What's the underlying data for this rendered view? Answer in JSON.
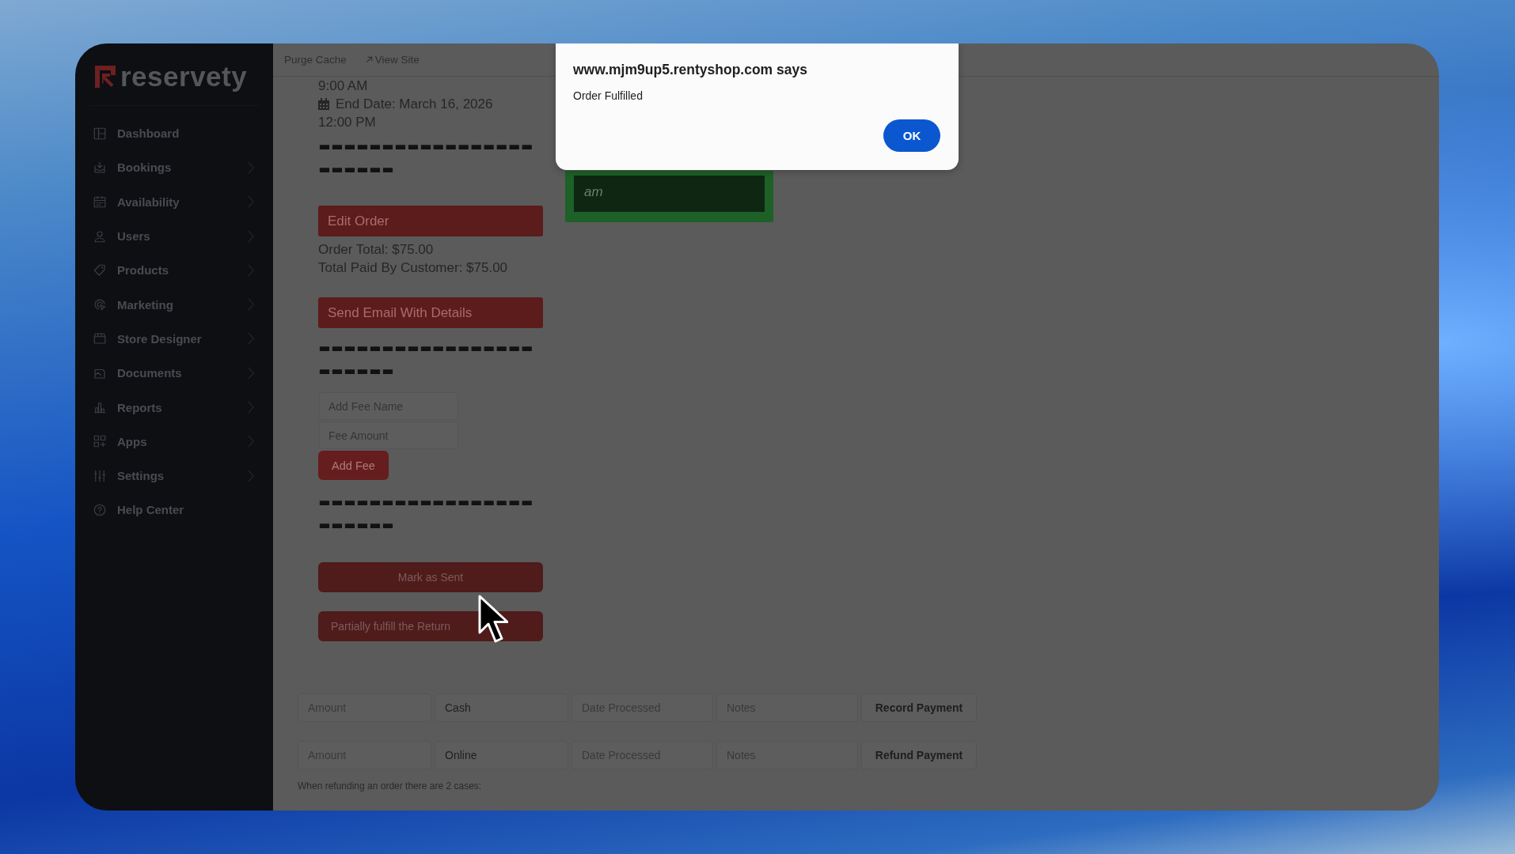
{
  "topbar": {
    "links": [
      {
        "label": "Purge Cache",
        "kind": "plain"
      },
      {
        "label": "View Site",
        "kind": "external"
      }
    ]
  },
  "sidebar": {
    "logo": "reservety",
    "items": [
      {
        "label": "Dashboard",
        "expandable": false
      },
      {
        "label": "Bookings",
        "expandable": true
      },
      {
        "label": "Availability",
        "expandable": true
      },
      {
        "label": "Users",
        "expandable": true
      },
      {
        "label": "Products",
        "expandable": true
      },
      {
        "label": "Marketing",
        "expandable": true
      },
      {
        "label": "Store Designer",
        "expandable": true
      },
      {
        "label": "Documents",
        "expandable": true
      },
      {
        "label": "Reports",
        "expandable": true
      },
      {
        "label": "Apps",
        "expandable": true
      },
      {
        "label": "Settings",
        "expandable": true
      },
      {
        "label": "Help Center",
        "expandable": false
      }
    ]
  },
  "order": {
    "blocks": [
      {
        "kind": "text",
        "text": "9:00 AM"
      },
      {
        "kind": "date",
        "text": "End Date: March 16, 2026"
      },
      {
        "kind": "text",
        "text": "12:00 PM"
      },
      {
        "kind": "divider",
        "text": "-----------------------"
      },
      {
        "kind": "button",
        "label": "Edit Order"
      },
      {
        "kind": "text",
        "text": "Order Total: $75.00"
      },
      {
        "kind": "text",
        "text": "Total Paid By Customer: $75.00"
      },
      {
        "kind": "button",
        "label": "Send Email With Details"
      },
      {
        "kind": "divider",
        "text": "-----------------------"
      },
      {
        "kind": "fee_form",
        "fields": [
          {
            "placeholder": "Add Fee Name"
          },
          {
            "placeholder": "Fee Amount"
          }
        ],
        "button": "Add Fee"
      },
      {
        "kind": "divider",
        "text": "-----------------------"
      },
      {
        "kind": "action",
        "label": "Mark as Sent",
        "centered": true
      },
      {
        "kind": "action",
        "label": "Partially fulfill the Return",
        "centered": false
      }
    ]
  },
  "note": {
    "text": "am"
  },
  "payments": {
    "rows": [
      {
        "amount_placeholder": "Amount",
        "method": "Cash",
        "date_placeholder": "Date Processed",
        "notes_placeholder": "Notes",
        "button": "Record Payment"
      },
      {
        "amount_placeholder": "Amount",
        "method": "Online",
        "date_placeholder": "Date Processed",
        "notes_placeholder": "Notes",
        "button": "Refund Payment"
      }
    ],
    "help_text": "When refunding an order there are 2 cases:"
  },
  "dialog": {
    "title": "www.mjm9up5.rentyshop.com says",
    "message": "Order Fulfilled",
    "button": "OK"
  }
}
